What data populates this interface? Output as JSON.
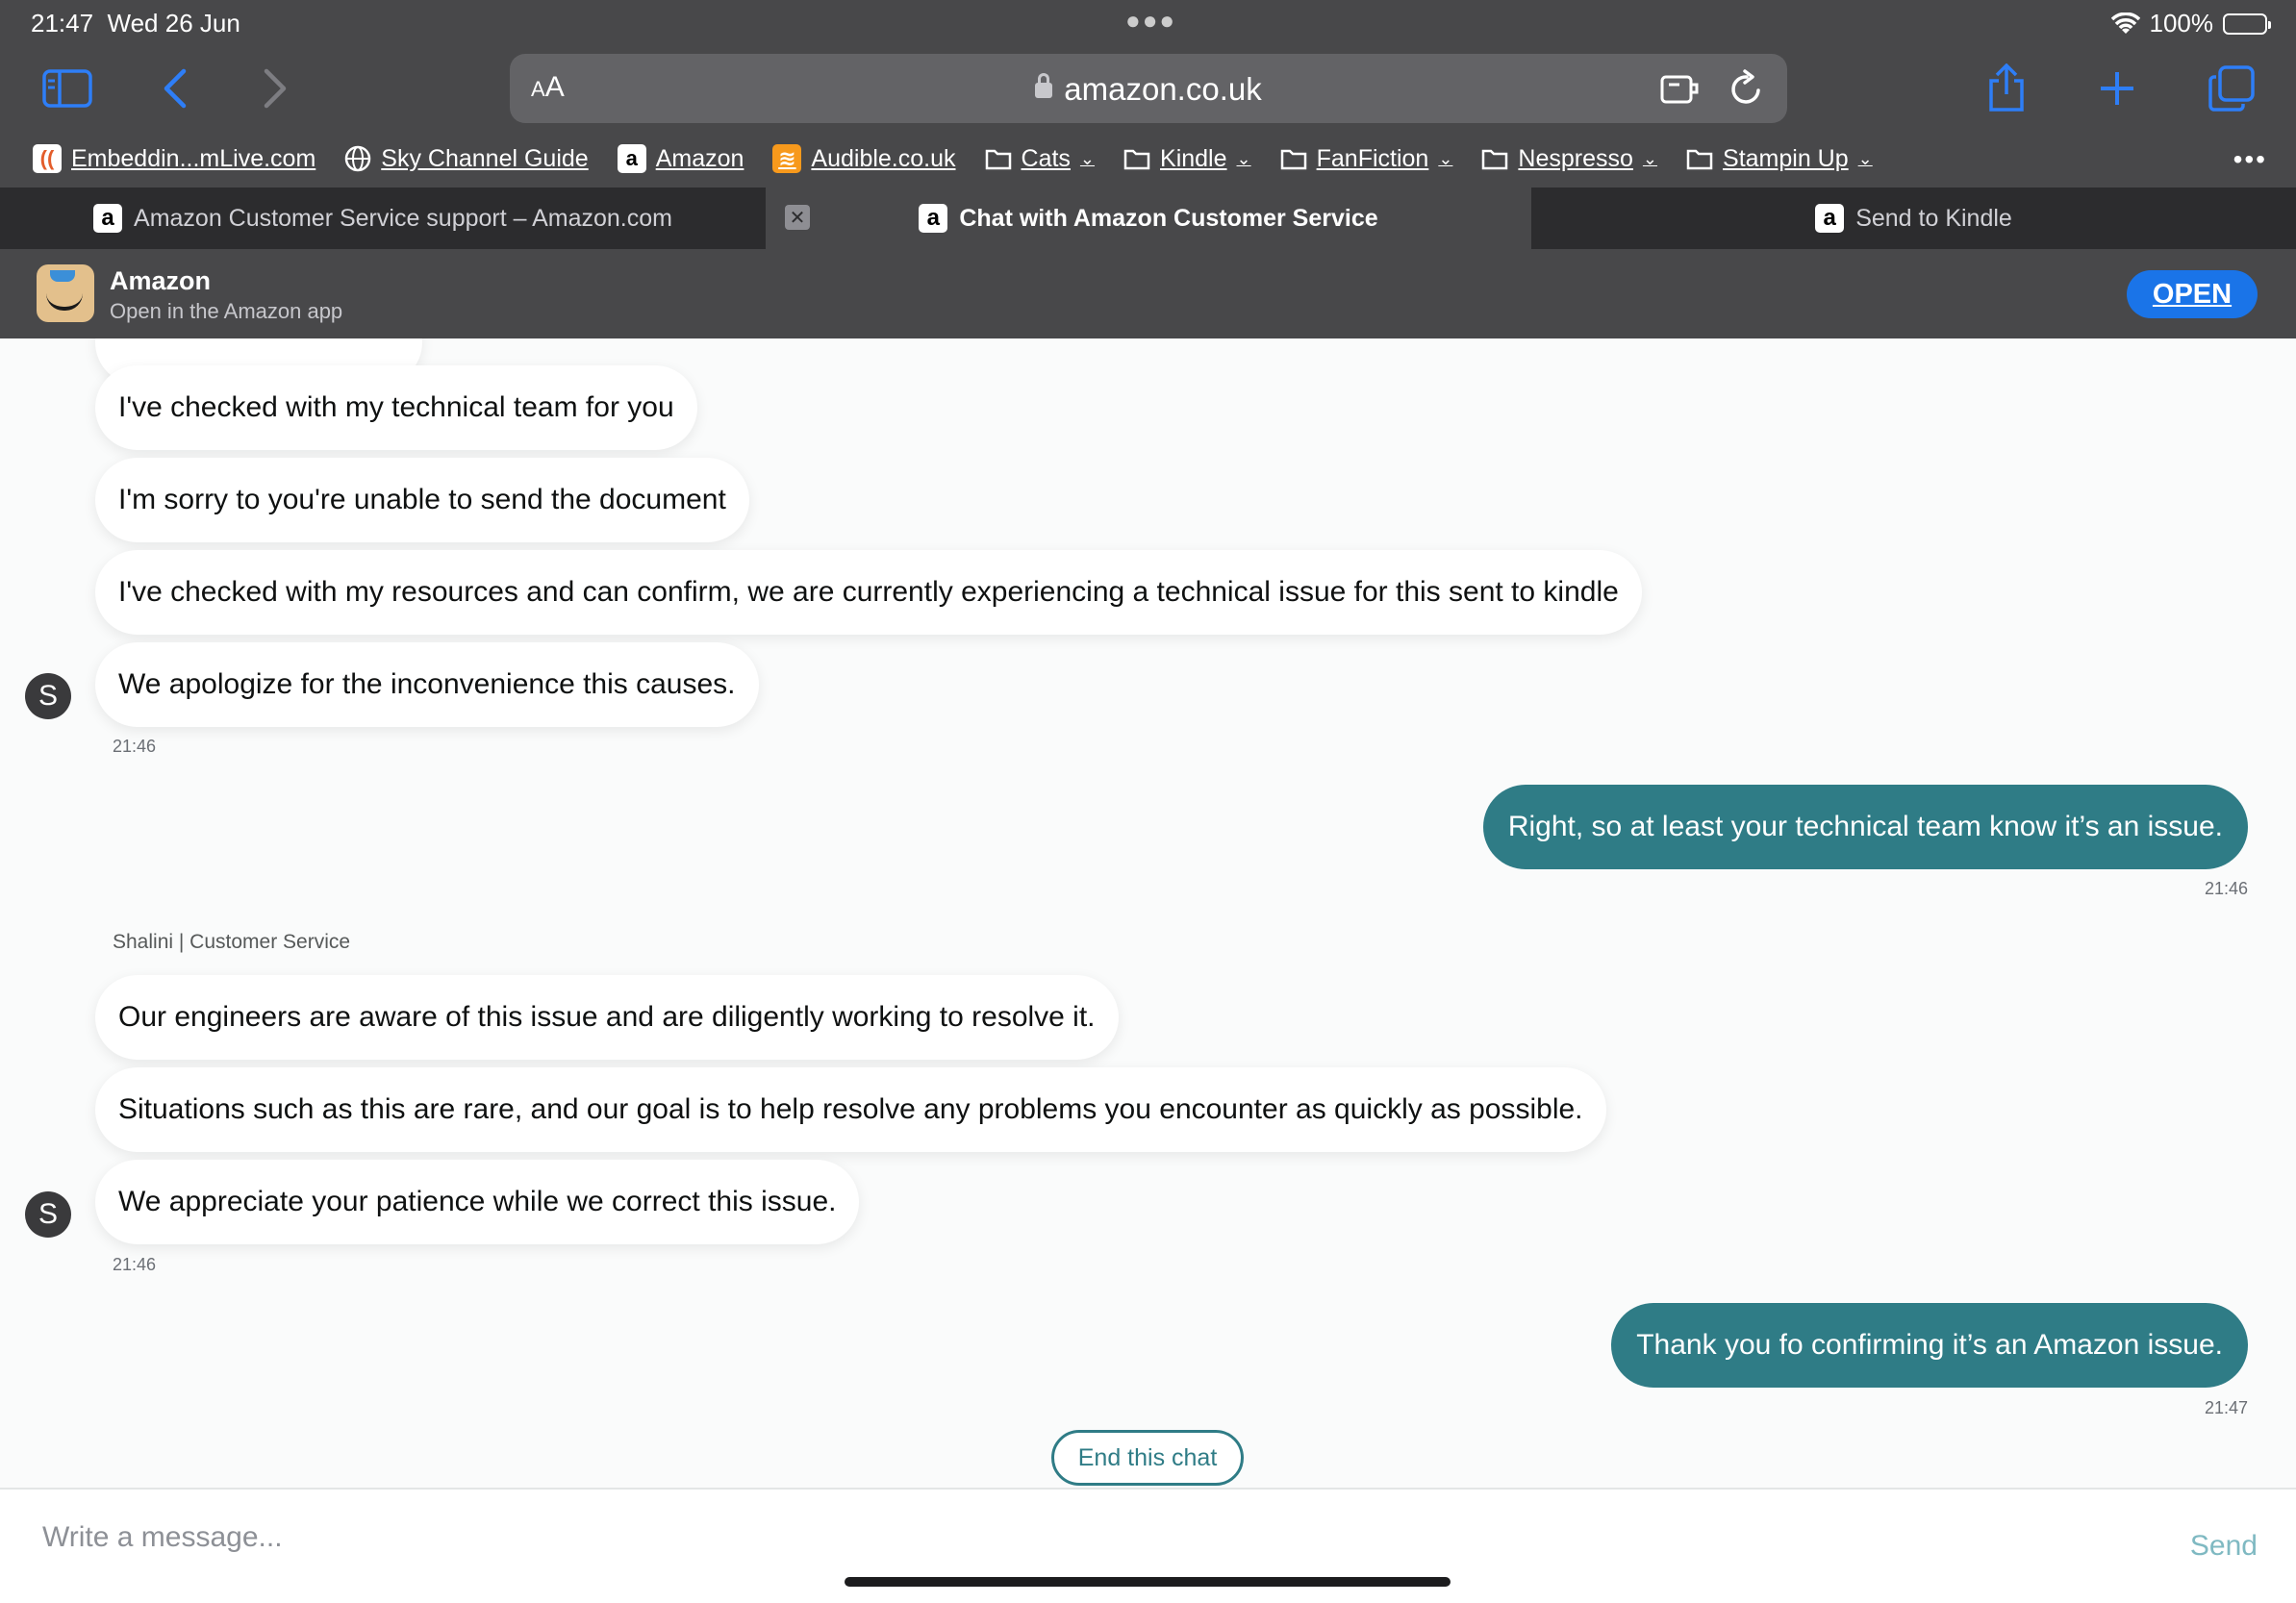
{
  "status_bar": {
    "time": "21:47",
    "date": "Wed 26 Jun",
    "battery": "100%",
    "battery_level": 1.0
  },
  "toolbar": {
    "url_text_size": "AA",
    "url": "amazon.co.uk"
  },
  "bookmarks": [
    {
      "label": "Embeddin...mLive.com",
      "icon": "embedded-favicon"
    },
    {
      "label": "Sky Channel Guide",
      "icon": "globe-icon"
    },
    {
      "label": "Amazon",
      "icon": "amazon-favicon"
    },
    {
      "label": "Audible.co.uk",
      "icon": "audible-favicon"
    },
    {
      "label": "Cats",
      "icon": "folder-icon"
    },
    {
      "label": "Kindle",
      "icon": "folder-icon"
    },
    {
      "label": "FanFiction",
      "icon": "folder-icon"
    },
    {
      "label": "Nespresso",
      "icon": "folder-icon"
    },
    {
      "label": "Stampin Up",
      "icon": "folder-icon"
    }
  ],
  "tabs": [
    {
      "label": "Amazon Customer Service support – Amazon.com"
    },
    {
      "label": "Chat with Amazon Customer Service",
      "active": true
    },
    {
      "label": "Send to Kindle"
    }
  ],
  "app_banner": {
    "title": "Amazon",
    "subtitle": "Open in the Amazon app",
    "open_label": "OPEN"
  },
  "chat": {
    "agent_initial": "S",
    "agent_label": "Shalini | Customer Service",
    "group1": [
      "I've checked with my technical team for you",
      "I'm sorry to you're unable to send the document",
      "I've checked with my resources and can confirm, we are currently experiencing a technical issue for this sent to kindle",
      "We apologize for the inconvenience this causes."
    ],
    "group1_time": "21:46",
    "user_msg1": "Right, so at least your technical team know it’s an issue.",
    "user_msg1_time": "21:46",
    "group2": [
      "Our engineers are aware of this issue and are diligently working to resolve it.",
      "Situations such as this are rare, and our goal is to help resolve any problems you encounter as quickly as possible.",
      "We appreciate your patience while we correct this issue."
    ],
    "group2_time": "21:46",
    "user_msg2": "Thank you fo confirming it’s an Amazon issue.",
    "user_msg2_time": "21:47",
    "end_chat_label": "End this chat"
  },
  "composer": {
    "placeholder": "Write a message...",
    "send_label": "Send"
  },
  "colors": {
    "accent_teal": "#2f7c86",
    "safari_blue": "#2e7ef7",
    "open_button": "#1a74e8"
  }
}
